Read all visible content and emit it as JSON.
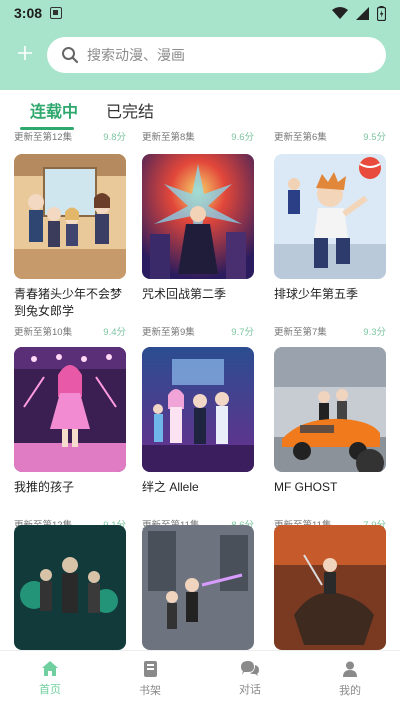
{
  "status_bar": {
    "time": "3:08"
  },
  "search": {
    "placeholder": "搜索动漫、漫画"
  },
  "tabs": [
    {
      "label": "连载中",
      "active": true
    },
    {
      "label": "已完结",
      "active": false
    }
  ],
  "partial_row": [
    {
      "episodes": "更新至第12集",
      "score": "9.8分"
    },
    {
      "episodes": "更新至第8集",
      "score": "9.6分"
    },
    {
      "episodes": "更新至第6集",
      "score": "9.5分"
    }
  ],
  "cards": [
    {
      "title": "青春猪头少年不会梦到兔女郎学",
      "episodes": "更新至第10集",
      "score": "9.4分"
    },
    {
      "title": "咒术回战第二季",
      "episodes": "更新至第9集",
      "score": "9.7分"
    },
    {
      "title": "排球少年第五季",
      "episodes": "更新至第7集",
      "score": "9.3分"
    },
    {
      "title": "我推的孩子",
      "episodes": "更新至第12集",
      "score": "9.1分"
    },
    {
      "title": "绊之 Allele",
      "episodes": "更新至第11集",
      "score": "8.6分"
    },
    {
      "title": "MF GHOST",
      "episodes": "更新至第11集",
      "score": "7.9分"
    }
  ],
  "nav": [
    {
      "label": "首页",
      "icon": "home-icon",
      "active": true
    },
    {
      "label": "书架",
      "icon": "bookshelf-icon",
      "active": false
    },
    {
      "label": "对话",
      "icon": "chat-icon",
      "active": false
    },
    {
      "label": "我的",
      "icon": "profile-icon",
      "active": false
    }
  ],
  "colors": {
    "header_bg": "#a8e4cb",
    "accent": "#2fa86d",
    "score": "#7ec6a2",
    "nav_active": "#6fcf9e"
  }
}
